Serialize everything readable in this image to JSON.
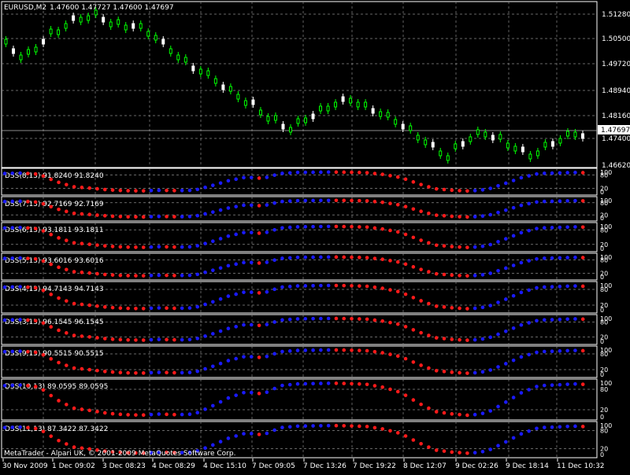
{
  "header": {
    "symbol": "EURUSD,M2",
    "ohlc": "1.47600 1.47727 1.47600 1.47697"
  },
  "price_axis": {
    "ticks": [
      "1.51280",
      "1.50500",
      "1.49720",
      "1.48940",
      "1.48160",
      "1.47697",
      "1.47400",
      "1.46620"
    ],
    "current_price": "1.47697"
  },
  "indicators": [
    {
      "label": "DSS(8,13) 91.8240 91.8240"
    },
    {
      "label": "DSS(7,13) 92.7169 92.7169"
    },
    {
      "label": "DSS(6,13) 93.1811 93.1811"
    },
    {
      "label": "DSS(5,13) 93.6016 93.6016"
    },
    {
      "label": "DSS(4,13) 94.7143 94.7143"
    },
    {
      "label": "DSS(3,13) 96.1545 96.1545"
    },
    {
      "label": "DSS(9,13) 90.5515 90.5515"
    },
    {
      "label": "DSS(10,13) 89.0595 89.0595"
    },
    {
      "label": "DSS(11,13) 87.3422 87.3422"
    }
  ],
  "indicator_axis": {
    "top": "100",
    "mid1": "80",
    "mid2": "20",
    "bottom": "0"
  },
  "time_axis": [
    "30 Nov 2009",
    "1 Dec 09:02",
    "3 Dec 08:23",
    "4 Dec 08:29",
    "4 Dec 15:10",
    "7 Dec 09:05",
    "7 Dec 13:26",
    "7 Dec 19:22",
    "8 Dec 12:07",
    "9 Dec 02:26",
    "9 Dec 18:14",
    "11 Dec 10:32"
  ],
  "footer": {
    "copyright": "MetaTrader - Alpari UK, © 2001-2009 MetaQuotes Software Corp."
  },
  "colors": {
    "up_dot": "#1a1aff",
    "down_dot": "#ff1a1a",
    "candle_bull": "#00ff00",
    "candle_bear": "#ffffff",
    "grid": "#8a8a8a"
  }
}
